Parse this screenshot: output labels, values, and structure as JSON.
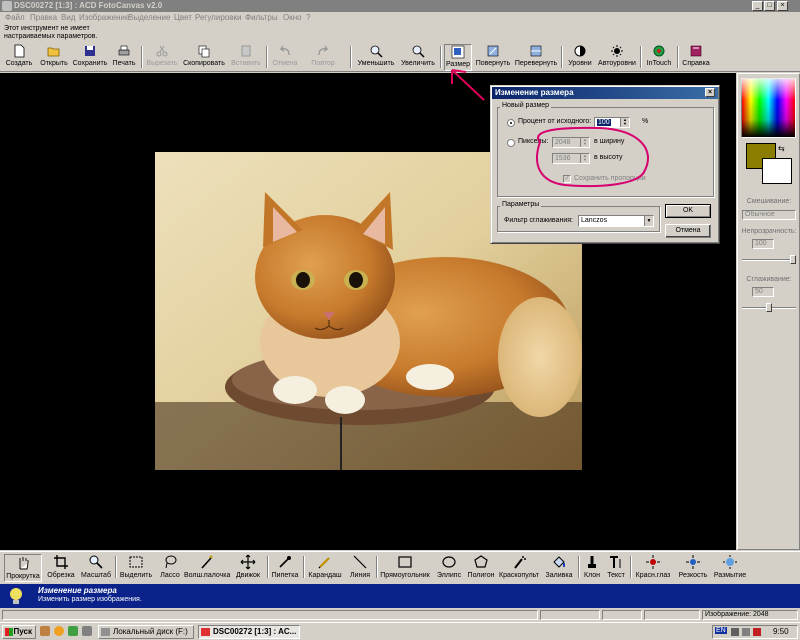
{
  "window": {
    "title": "DSC00272 [1:3] : ACD FotoCanvas v2.0",
    "controls": [
      "_",
      "□",
      "×"
    ]
  },
  "menu": [
    "Файл",
    "Правка",
    "Вид",
    "Изображение",
    "Выделение",
    "Цвет",
    "Регулировки",
    "Фильтры",
    "Окно",
    "?"
  ],
  "hint": "Этот инструмент не имеет настраиваемых параметров.",
  "toolbar": [
    {
      "label": "Создать",
      "icon": "new-file-icon"
    },
    {
      "label": "Открыть",
      "icon": "open-folder-icon"
    },
    {
      "label": "Сохранить",
      "icon": "floppy-disk-icon"
    },
    {
      "label": "Печать",
      "icon": "printer-icon"
    },
    {
      "label": "Вырезать",
      "icon": "scissors-icon"
    },
    {
      "label": "Скопировать",
      "icon": "copy-icon"
    },
    {
      "label": "Вставить",
      "icon": "paste-icon"
    },
    {
      "label": "Отмена",
      "icon": "undo-icon"
    },
    {
      "label": "Повтор",
      "icon": "redo-icon"
    },
    {
      "label": "Уменьшить",
      "icon": "zoom-out-icon"
    },
    {
      "label": "Увеличить",
      "icon": "zoom-in-icon"
    },
    {
      "label": "Размер",
      "icon": "resize-icon"
    },
    {
      "label": "Повернуть",
      "icon": "rotate-icon"
    },
    {
      "label": "Перевернуть",
      "icon": "flip-icon"
    },
    {
      "label": "Уровни",
      "icon": "levels-icon"
    },
    {
      "label": "Автоуровни",
      "icon": "auto-levels-icon"
    },
    {
      "label": "InTouch",
      "icon": "globe-icon"
    },
    {
      "label": "Справка",
      "icon": "help-book-icon"
    }
  ],
  "dialog": {
    "title": "Изменение размера",
    "group_new_size": "Новый размер",
    "percent_label": "Процент от исходного:",
    "percent_value": "100",
    "percent_unit": "%",
    "pixels_label": "Пикселы:",
    "width_value": "2048",
    "width_label": "в ширину",
    "height_value": "1536",
    "height_label": "в высоту",
    "keep_ratio_label": "Сохранить пропорции",
    "group_params": "Параметры",
    "filter_label": "Фильтр сглаживания:",
    "filter_value": "Lanczos",
    "ok_label": "OK",
    "cancel_label": "Отмена"
  },
  "right_panel": {
    "foreground_color": "#8b7d00",
    "background_color": "#ffffff",
    "blend_label": "Смешивание:",
    "blend_value": "Обычное",
    "opacity_label": "Непрозрачность:",
    "opacity_value": "100",
    "smooth_label": "Сглаживание:",
    "smooth_value": "50"
  },
  "tools": [
    {
      "label": "Прокрутка",
      "icon": "hand-icon"
    },
    {
      "label": "Обрезка",
      "icon": "crop-icon"
    },
    {
      "label": "Масштаб",
      "icon": "magnifier-icon"
    },
    {
      "label": "Выделить",
      "icon": "rect-select-icon"
    },
    {
      "label": "Лассо",
      "icon": "lasso-icon"
    },
    {
      "label": "Волш.палочка",
      "icon": "magic-wand-icon"
    },
    {
      "label": "Движок",
      "icon": "move-icon"
    },
    {
      "label": "Пипетка",
      "icon": "eyedropper-icon"
    },
    {
      "label": "Карандаш",
      "icon": "pencil-icon"
    },
    {
      "label": "Линия",
      "icon": "line-icon"
    },
    {
      "label": "Прямоугольник",
      "icon": "rectangle-icon"
    },
    {
      "label": "Эллипс",
      "icon": "ellipse-icon"
    },
    {
      "label": "Полигон",
      "icon": "polygon-icon"
    },
    {
      "label": "Краскопульт",
      "icon": "airbrush-icon"
    },
    {
      "label": "Заливка",
      "icon": "fill-bucket-icon"
    },
    {
      "label": "Клон",
      "icon": "clone-stamp-icon"
    },
    {
      "label": "Текст",
      "icon": "text-icon"
    },
    {
      "label": "Красн.глаз",
      "icon": "red-eye-icon"
    },
    {
      "label": "Резкость",
      "icon": "sharpen-icon"
    },
    {
      "label": "Размытие",
      "icon": "blur-icon"
    }
  ],
  "status": {
    "title": "Изменение размера",
    "description": "Изменить размер изображения."
  },
  "infobar": {
    "image_info": "Изображение: 2048"
  },
  "taskbar": {
    "start_label": "Пуск",
    "tasks": [
      "Локальный диск (F:)",
      "DSC00272 [1:3] : AC..."
    ],
    "tray_lang": "EN",
    "clock": "9:50"
  },
  "colors": {
    "status_blue": "#0a2289",
    "annotation": "#d6006f",
    "arrow": "#e0005a"
  }
}
